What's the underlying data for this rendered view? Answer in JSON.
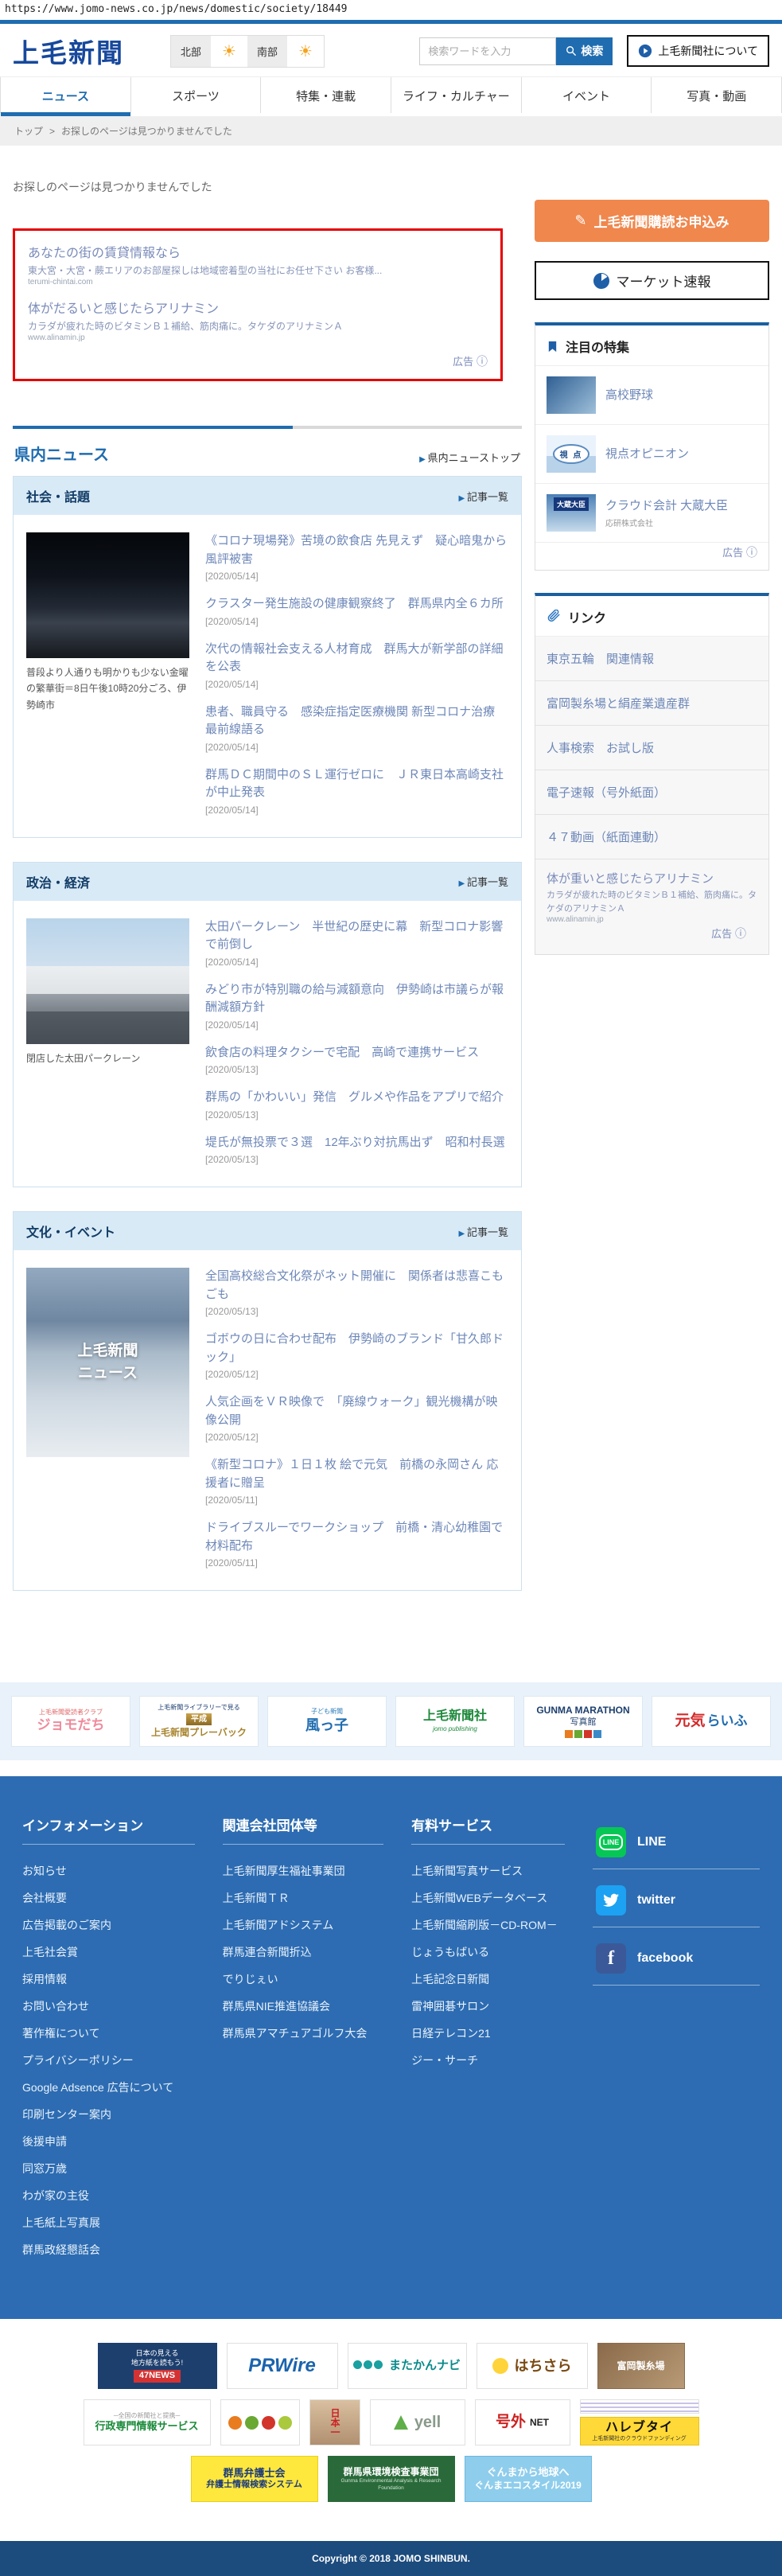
{
  "browser": {
    "url": "https://www.jomo-news.co.jp/news/domestic/society/18449"
  },
  "header": {
    "logo": "上毛新聞",
    "weather": {
      "north": "北部",
      "south": "南部"
    },
    "search_placeholder": "検索ワードを入力",
    "search_button": "検索",
    "about_button": "上毛新聞社について"
  },
  "nav": {
    "items": [
      "ニュース",
      "スポーツ",
      "特集・連載",
      "ライフ・カルチャー",
      "イベント",
      "写真・動画"
    ]
  },
  "breadcrumb": {
    "home": "トップ",
    "separator": ">",
    "current": "お探しのページは見つかりませんでした"
  },
  "main": {
    "not_found": "お探しのページは見つかりませんでした",
    "ad_box": {
      "ads": [
        {
          "title": "あなたの街の賃貸情報なら",
          "desc": "東大宮・大宮・蕨エリアのお部屋探しは地域密着型の当社にお任せ下さい お客様...",
          "url": "terumi-chintai.com"
        },
        {
          "title": "体がだるいと感じたらアリナミン",
          "desc": "カラダが疲れた時のビタミンＢ１補給、筋肉痛に。タケダのアリナミンＡ",
          "url": "www.alinamin.jp"
        }
      ],
      "ad_label": "広告"
    },
    "kennai_title": "県内ニュース",
    "kennai_top_link": "県内ニューストップ",
    "sections": [
      {
        "title": "社会・話題",
        "more": "記事一覧",
        "caption": "普段より人通りも明かりも少ない金曜の繁華街＝8日午後10時20分ごろ、伊勢崎市",
        "articles": [
          {
            "title": "《コロナ現場発》苦境の飲食店 先見えず　疑心暗鬼から風評被害",
            "date": "[2020/05/14]"
          },
          {
            "title": "クラスター発生施設の健康観察終了　群馬県内全６カ所",
            "date": "[2020/05/14]"
          },
          {
            "title": "次代の情報社会支える人材育成　群馬大が新学部の詳細を公表",
            "date": "[2020/05/14]"
          },
          {
            "title": "患者、職員守る　感染症指定医療機関 新型コロナ治療 最前線語る",
            "date": "[2020/05/14]"
          },
          {
            "title": "群馬ＤＣ期間中のＳＬ運行ゼロに　ＪＲ東日本高崎支社が中止発表",
            "date": "[2020/05/14]"
          }
        ]
      },
      {
        "title": "政治・経済",
        "more": "記事一覧",
        "caption": "閉店した太田パークレーン",
        "articles": [
          {
            "title": "太田パークレーン　半世紀の歴史に幕　新型コロナ影響で前倒し",
            "date": "[2020/05/14]"
          },
          {
            "title": "みどり市が特別職の給与減額意向　伊勢崎は市議らが報酬減額方針",
            "date": "[2020/05/14]"
          },
          {
            "title": "飲食店の料理タクシーで宅配　高崎で連携サービス",
            "date": "[2020/05/13]"
          },
          {
            "title": "群馬の「かわいい」発信　グルメや作品をアプリで紹介",
            "date": "[2020/05/13]"
          },
          {
            "title": "堤氏が無投票で３選　12年ぶり対抗馬出ず　昭和村長選",
            "date": "[2020/05/13]"
          }
        ]
      },
      {
        "title": "文化・イベント",
        "more": "記事一覧",
        "image_overlay": "上毛新聞ニュース",
        "articles": [
          {
            "title": "全国高校総合文化祭がネット開催に　関係者は悲喜こもごも",
            "date": "[2020/05/13]"
          },
          {
            "title": "ゴボウの日に合わせ配布　伊勢崎のブランド「甘久郎ドック」",
            "date": "[2020/05/12]"
          },
          {
            "title": "人気企画をＶＲ映像で　「廃線ウォーク」観光機構が映像公開",
            "date": "[2020/05/12]"
          },
          {
            "title": "《新型コロナ》１日１枚 絵で元気　前橋の永岡さん 応援者に贈呈",
            "date": "[2020/05/11]"
          },
          {
            "title": "ドライブスルーでワークショップ　前橋・清心幼稚園で材料配布",
            "date": "[2020/05/11]"
          }
        ]
      }
    ]
  },
  "sidebar": {
    "subscribe_button": "上毛新聞購読お申込み",
    "market_button": "マーケット速報",
    "features": {
      "title": "注目の特集",
      "items": [
        {
          "label": "高校野球"
        },
        {
          "label": "視点オピニオン",
          "thumb_text": "視 点"
        },
        {
          "label": "クラウド会計 大蔵大臣",
          "sub": "応研株式会社",
          "thumb_text": "大蔵大臣"
        }
      ],
      "ad_label": "広告"
    },
    "links": {
      "title": "リンク",
      "items": [
        "東京五輪　関連情報",
        "富岡製糸場と絹産業遺産群",
        "人事検索　お試し版",
        "電子速報（号外紙面）",
        "４７動画（紙面連動）"
      ],
      "ad": {
        "title": "体が重いと感じたらアリナミン",
        "desc": "カラダが疲れた時のビタミンＢ１補給、筋肉痛に。タケダのアリナミンＡ",
        "url": "www.alinamin.jp",
        "ad_label": "広告"
      }
    }
  },
  "partners": {
    "items": [
      {
        "line1": "上毛新聞愛読者クラブ",
        "line2": "ジョモだち"
      },
      {
        "line1": "上毛新聞ライブラリーで見る",
        "line2": "平成",
        "line3": "上毛新聞プレーバック"
      },
      {
        "line1": "子ども新聞",
        "line2": "風っ子"
      },
      {
        "line1": "上毛新聞社",
        "line2": "jomo publishing"
      },
      {
        "line1": "GUNMA MARATHON",
        "line2": "写真館"
      },
      {
        "line1": "元気",
        "line2": "らいふ"
      }
    ]
  },
  "footer": {
    "columns": [
      {
        "title": "インフォメーション",
        "links": [
          "お知らせ",
          "会社概要",
          "広告掲載のご案内",
          "上毛社会賞",
          "採用情報",
          "お問い合わせ",
          "著作権について",
          "プライバシーポリシー",
          "Google Adsence 広告について",
          "印刷センター案内",
          "後援申請",
          "同窓万歳",
          "わが家の主役",
          "上毛紙上写真展",
          "群馬政経懇話会"
        ]
      },
      {
        "title": "関連会社団体等",
        "links": [
          "上毛新聞厚生福祉事業団",
          "上毛新聞ＴＲ",
          "上毛新聞アドシステム",
          "群馬連合新聞折込",
          "でりじぇい",
          "群馬県NIE推進協議会",
          "群馬県アマチュアゴルフ大会"
        ]
      },
      {
        "title": "有料サービス",
        "links": [
          "上毛新聞写真サービス",
          "上毛新聞WEBデータベース",
          "上毛新聞縮刷版－CD-ROM－",
          "じょうもばいる",
          "上毛記念日新聞",
          "雷神囲碁サロン",
          "日経テレコン21",
          "ジー・サーチ"
        ]
      }
    ],
    "social": [
      "LINE",
      "twitter",
      "facebook"
    ]
  },
  "bottom": {
    "row1": [
      {
        "l1": "日本の見える",
        "l2": "地方紙を読もう!",
        "badge": "47NEWS"
      },
      {
        "main": "PRWire"
      },
      {
        "main": "またかんナビ"
      },
      {
        "main": "はちさら"
      },
      {
        "main": "富岡製糸場"
      }
    ],
    "row2": [
      {
        "l1": "─全国の新聞社と提携─",
        "main": "行政専門情報サービス"
      },
      {},
      {
        "main": "日本一"
      },
      {
        "main": "yell"
      },
      {
        "main": "号外",
        "sub": "NET"
      },
      {
        "main": "ハレブタイ",
        "sub": "上毛新聞社のクラウドファンディング"
      }
    ],
    "row3": [
      {
        "l1": "群馬弁護士会",
        "l2": "弁護士情報検索システム"
      },
      {
        "l1": "群馬県環境検査事業団",
        "l2": "Gunma Environmental Analysis & Research Foundation"
      },
      {
        "l1": "ぐんまから地球へ",
        "l2": "ぐんまエコスタイル2019"
      }
    ]
  },
  "copyright": "Copyright © 2018 JOMO SHINBUN."
}
